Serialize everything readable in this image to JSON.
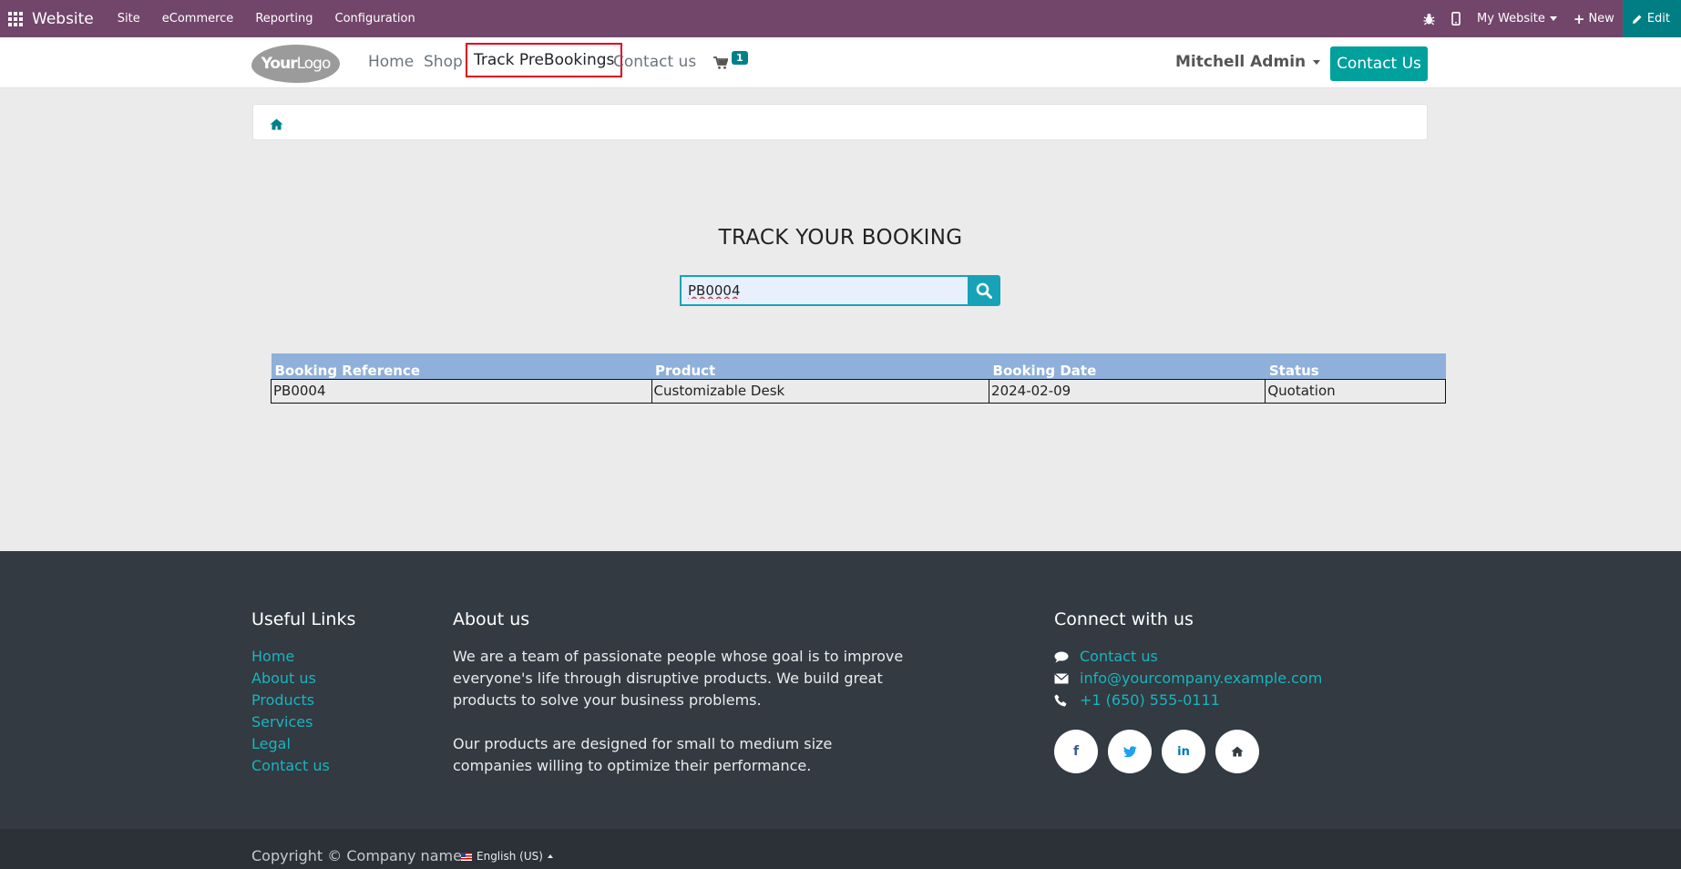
{
  "adminbar": {
    "brand": "Website",
    "menus": [
      "Site",
      "eCommerce",
      "Reporting",
      "Configuration"
    ],
    "website_selector": "My Website",
    "new_label": "New",
    "edit_label": "Edit"
  },
  "header": {
    "logo_text_bold": "Your",
    "logo_text": "Logo",
    "nav": [
      "Home",
      "Shop",
      "Track PreBookings",
      "Contact us"
    ],
    "active_nav": "Track PreBookings",
    "cart_count": "1",
    "user": "Mitchell Admin",
    "contact_button": "Contact Us"
  },
  "tracking": {
    "title": "TRACK YOUR BOOKING",
    "search_value": "PB0004"
  },
  "results": {
    "headers": [
      "Booking Reference",
      "Product",
      "Booking Date",
      "Status"
    ],
    "rows": [
      [
        "PB0004",
        "Customizable Desk",
        "2024-02-09",
        "Quotation"
      ]
    ]
  },
  "footer": {
    "useful_links_title": "Useful Links",
    "useful_links": [
      "Home",
      "About us",
      "Products",
      "Services",
      "Legal",
      "Contact us"
    ],
    "about_title": "About us",
    "about_p1": "We are a team of passionate people whose goal is to improve everyone's life through disruptive products. We build great products to solve your business problems.",
    "about_p2": "Our products are designed for small to medium size companies willing to optimize their performance.",
    "connect_title": "Connect with us",
    "connect_contact": "Contact us",
    "connect_email": "info@yourcompany.example.com",
    "connect_phone": "+1 (650) 555-0111",
    "copyright": "Copyright © Company name",
    "language": "English (US)"
  },
  "colors": {
    "admin_bar": "#71466a",
    "accent": "#00a09d",
    "table_header": "#8eb0da",
    "footer": "#333a41",
    "link": "#17b5c0"
  }
}
